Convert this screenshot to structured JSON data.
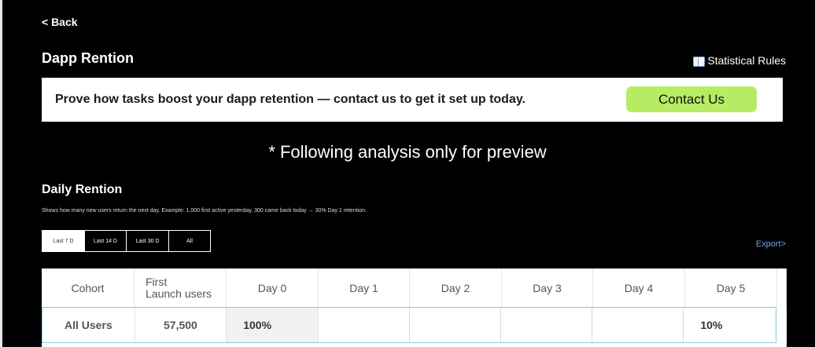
{
  "back_label": "< Back",
  "page_title": "Dapp Rention",
  "statistical_rules_label": "Statistical Rules",
  "banner": {
    "text": "Prove how tasks boost your dapp retention — contact us to get it set up today.",
    "contact_button": "Contact Us"
  },
  "preview_note": "* Following analysis only for preview",
  "daily_retention": {
    "title": "Daily Rention",
    "description": "Shows how many new users return the next day. Example: 1,000 first active yesterday, 300 came back today → 30% Day 1 retention.",
    "range_tabs": [
      "Last 7 D",
      "Last 14 D",
      "Last 30 D",
      "All"
    ],
    "active_tab": "Last 7 D",
    "export_label": "Export>"
  },
  "table": {
    "headers": [
      "Cohort",
      "First\nLaunch users",
      "Day 0",
      "Day 1",
      "Day 2",
      "Day 3",
      "Day 4",
      "Day 5"
    ],
    "header_first_launch_line1": "First",
    "header_first_launch_line2": "Launch users",
    "rows": [
      {
        "cohort": "All Users",
        "first_launch_users": "57,500",
        "day0": "100%",
        "day1": "",
        "day2": "",
        "day3": "",
        "day4": "",
        "day5": "10%"
      }
    ]
  },
  "colors": {
    "background": "#000000",
    "contact_button": "#b5ec63",
    "export_link": "#6ea6ea",
    "row_border": "#8fc4e0"
  },
  "icons": {
    "statistical_rules": "open-book-icon"
  }
}
